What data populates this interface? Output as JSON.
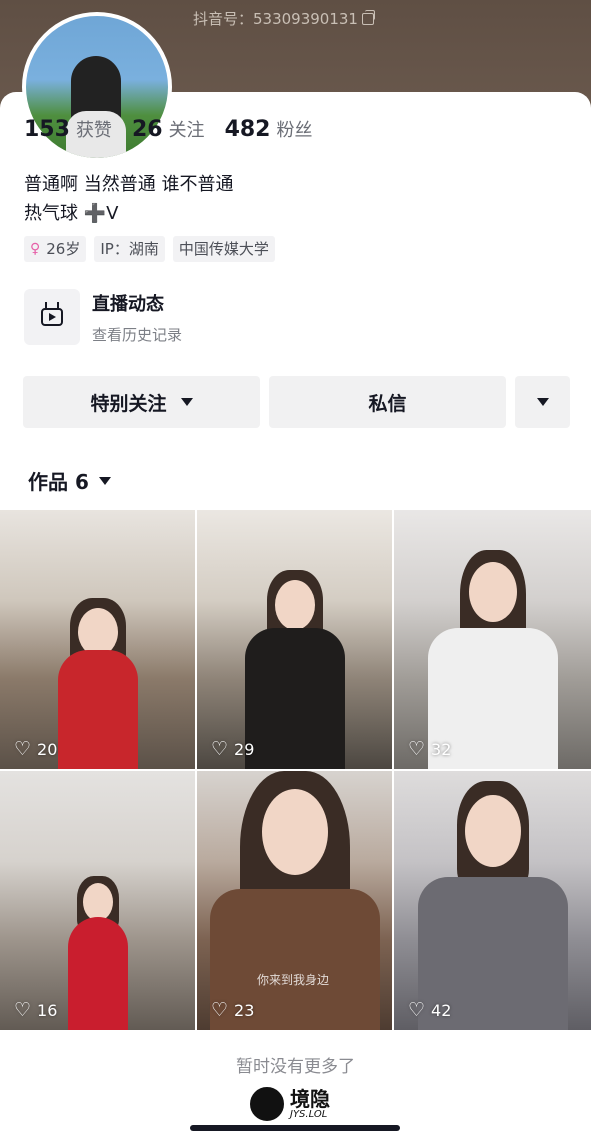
{
  "profile": {
    "douyin_id": "抖音号：53309390131",
    "stats": [
      {
        "num": "153",
        "label": "获赞"
      },
      {
        "num": "26",
        "label": "关注"
      },
      {
        "num": "482",
        "label": "粉丝"
      }
    ],
    "bio_line1": "普通啊  当然普通  谁不普通",
    "bio_line2": "热气球 ➕V",
    "tags": {
      "age": "26岁",
      "ip": "IP：湖南",
      "school": "中国传媒大学"
    }
  },
  "live": {
    "title": "直播动态",
    "subtitle": "查看历史记录"
  },
  "actions": {
    "follow_label": "特别关注",
    "message_label": "私信"
  },
  "works": {
    "label": "作品 6",
    "items": [
      {
        "likes": "20"
      },
      {
        "likes": "29"
      },
      {
        "likes": "32"
      },
      {
        "likes": "16"
      },
      {
        "likes": "23",
        "caption": "你来到我身边"
      },
      {
        "likes": "42"
      }
    ]
  },
  "footer": {
    "no_more": "暂时没有更多了",
    "watermark": "境隐",
    "watermark_sub": "JYS.LOL"
  },
  "icons": [
    "copy-icon",
    "female-icon",
    "tv-icon",
    "caret-down-icon",
    "heart-icon"
  ]
}
